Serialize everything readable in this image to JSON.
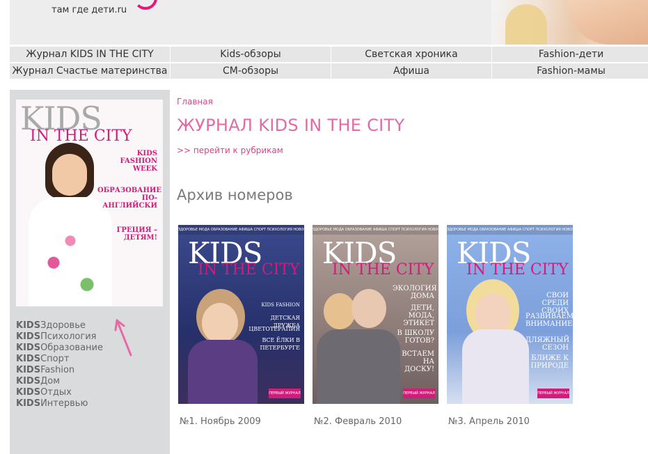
{
  "header": {
    "tagline": "там где дети.ru"
  },
  "nav": {
    "row1": [
      "Журнал KIDS IN THE CITY",
      "Kids-обзоры",
      "Светская хроника",
      "Fashion-дети"
    ],
    "row2": [
      "Журнал Счастье материнства",
      "СМ-обзоры",
      "Афиша",
      "Fashion-мамы"
    ]
  },
  "sidebar": {
    "cover": {
      "title_kids": "KIDS",
      "title_city": "IN THE CITY",
      "headline1": "KIDS FASHION WEEK",
      "headline2": "ОБРАЗОВАНИЕ ПО-АНГЛИЙСКИ",
      "headline3": "ГРЕЦИЯ – ДЕТЯМ!"
    },
    "rubric_prefix": "KIDS",
    "rubrics": [
      "Здоровье",
      "Психология",
      "Образование",
      "Спорт",
      "Fashion",
      "Дом",
      "Отдых",
      "Интервью"
    ]
  },
  "main": {
    "breadcrumb": "Главная",
    "title": "ЖУРНАЛ KIDS IN THE CITY",
    "rubrics_link": ">> перейти к рубрикам",
    "archive_title": "Архив номеров",
    "issues": [
      {
        "caption": "№1. Ноябрь 2009",
        "kids": "KIDS",
        "city": "IN THE CITY",
        "lines": [
          "KIDS FASHION",
          "ДЕТСКАЯ ДРУЖБА",
          "ЦВЕТОТЕРАПИЯ",
          "ВСЕ ЁЛКИ В ПЕТЕРБУРГЕ"
        ],
        "bg": "#2f3b78"
      },
      {
        "caption": "№2. Февраль 2010",
        "kids": "KIDS",
        "city": "IN THE CITY",
        "lines": [
          "ЭКОЛОГИЯ ДОМА",
          "ДЕТИ, МОДА, ЭТИКЕТ",
          "В ШКОЛУ ГОТОВ?",
          "ВСТАЕМ НА ДОСКУ!"
        ],
        "bg": "#a08a84"
      },
      {
        "caption": "№3. Апрель 2010",
        "kids": "KIDS",
        "city": "IN THE CITY",
        "lines": [
          "СВОИ СРЕДИ СВОИХ",
          "РАЗВИВАЕМ ВНИМАНИЕ",
          "ДЛЯЖНЫЙ СЕЗОН",
          "БЛИЖЕ К ПРИРОДЕ"
        ],
        "bg": "#7fa2dc"
      }
    ]
  },
  "colors": {
    "accent": "#e2418e",
    "nav_bg": "#e6e6e7",
    "sidebar_bg": "#dadbdc"
  }
}
